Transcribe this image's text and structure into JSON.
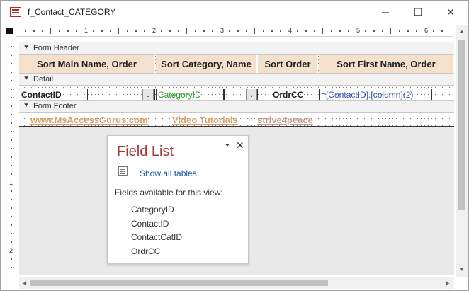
{
  "window": {
    "title": "f_Contact_CATEGORY",
    "minimize": "─",
    "maximize": "☐",
    "close": "✕"
  },
  "ruler": {
    "h_numbers": [
      "1",
      "2",
      "3",
      "4",
      "5",
      "6"
    ],
    "v_numbers": [
      "1",
      "2"
    ]
  },
  "sections": {
    "header": "Form Header",
    "detail": "Detail",
    "footer": "Form Footer",
    "arrow": "⯆"
  },
  "header_labels": [
    "Sort Main Name, Order",
    "Sort Category, Name",
    "Sort Order",
    "Sort First Name, Order"
  ],
  "detail": {
    "contact_id": "ContactID",
    "category_id": "CategoryID",
    "ordrcc": "OrdrCC",
    "formula": "=[ContactID].[column](2)",
    "combo_glyph": "⌄"
  },
  "footer": {
    "link1": "www.MsAccessGurus.com",
    "link2": "Video Tutorials",
    "link3": "strive4peace"
  },
  "field_list": {
    "title": "Field List",
    "dropdown": "⏷",
    "close": "✕",
    "show_all": "Show all tables",
    "available_label": "Fields available for this view:",
    "fields": [
      "CategoryID",
      "ContactID",
      "ContactCatID",
      "OrdrCC"
    ]
  },
  "scrollbars": {
    "up": "▲",
    "down": "▼",
    "left": "◀",
    "right": "▶"
  },
  "colors": {
    "header_fill": "#f5e0cc",
    "field_list_title": "#a4373a",
    "link": "#1a5aa8",
    "category_text": "#2e9a2e",
    "formula_text": "#3a55a8",
    "footer_text": "#d9a06a"
  }
}
